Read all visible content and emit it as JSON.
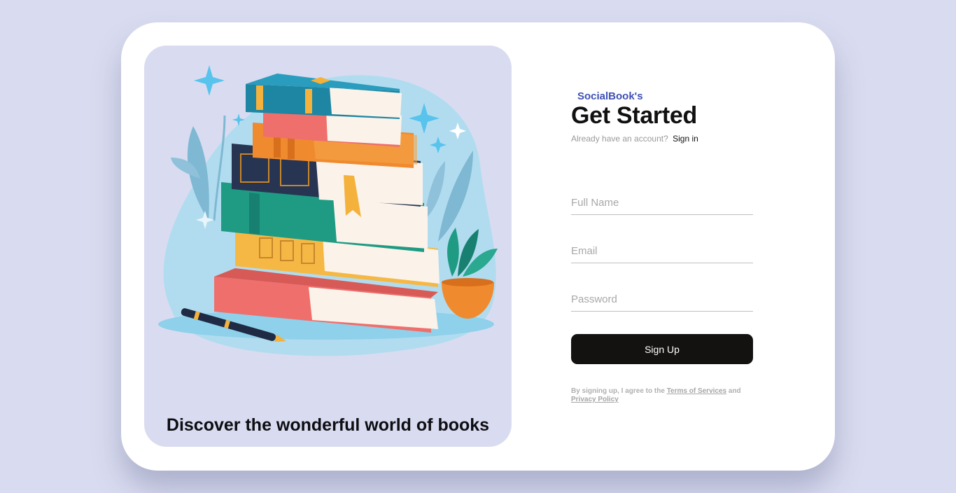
{
  "hero": {
    "tagline": "Discover the wonderful world of books"
  },
  "form": {
    "brand": "SocialBook's",
    "title": "Get Started",
    "account_prompt": "Already have an account?",
    "signin_label": "Sign in",
    "fields": {
      "full_name": {
        "placeholder": "Full Name",
        "value": ""
      },
      "email": {
        "placeholder": "Email",
        "value": ""
      },
      "password": {
        "placeholder": "Password",
        "value": ""
      }
    },
    "submit_label": "Sign Up",
    "terms": {
      "prefix": "By signing up, I agree to the",
      "terms_link": "Terms of Services",
      "joiner": "and",
      "privacy_link": "Privacy Policy"
    }
  },
  "colors": {
    "page_background": "#d9dcf0",
    "card_background": "#ffffff",
    "brand": "#3f51b5",
    "button": "#141211"
  }
}
